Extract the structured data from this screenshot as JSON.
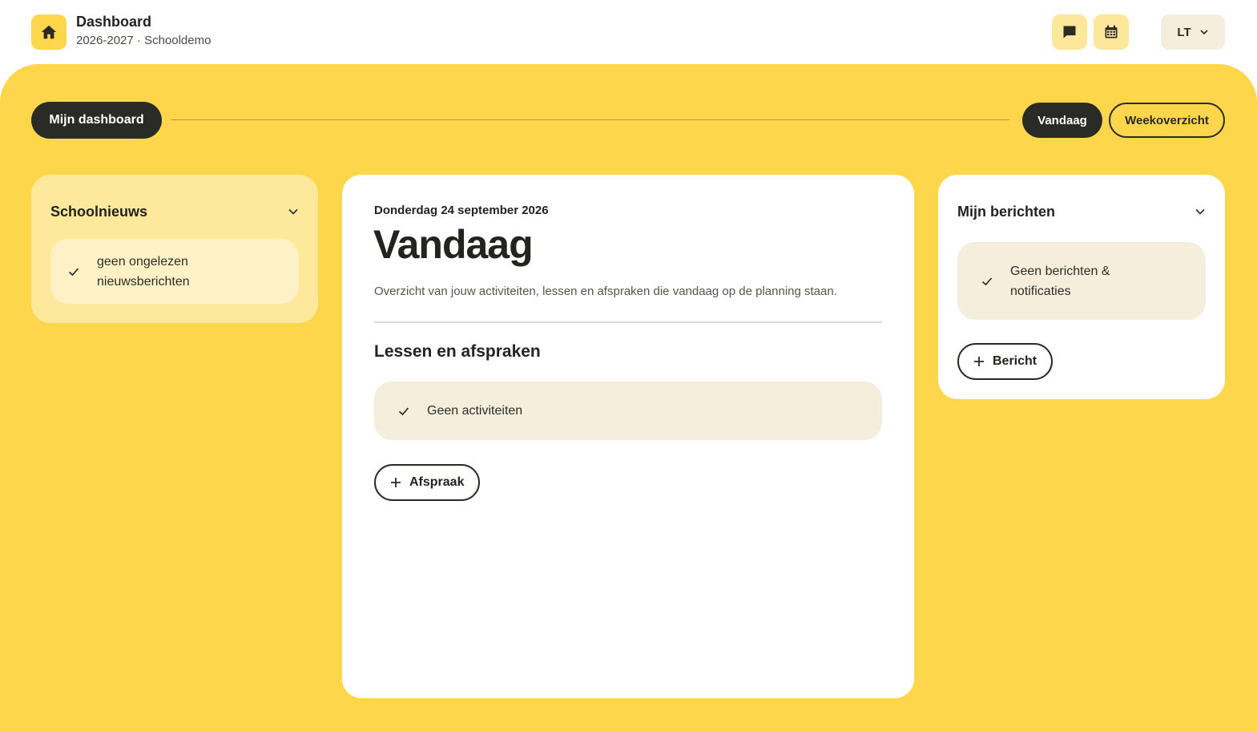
{
  "header": {
    "title": "Dashboard",
    "subtitle": "2026-2027 · Schooldemo",
    "home_icon": "home-icon",
    "messages_icon": "chat-icon",
    "calendar_icon": "calendar-icon",
    "user_initials": "LT"
  },
  "nav": {
    "dashboard_label": "Mijn dashboard",
    "today_label": "Vandaag",
    "week_label": "Weekoverzicht"
  },
  "news": {
    "heading": "Schoolnieuws",
    "empty_text": "geen ongelezen nieuwsberichten"
  },
  "today": {
    "date": "Donderdag 24 september 2026",
    "title": "Vandaag",
    "description": "Overzicht van jouw activiteiten, lessen en afspraken die vandaag op de planning staan.",
    "section_title": "Lessen en afspraken",
    "empty_text": "Geen activiteiten",
    "add_label": "Afspraak"
  },
  "messages": {
    "heading": "Mijn berichten",
    "empty_text": "Geen berichten & notificaties",
    "add_label": "Bericht"
  },
  "colors": {
    "brand_yellow": "#fdd64c",
    "dark": "#2a2b27",
    "empty_bg": "#f5eedd"
  }
}
